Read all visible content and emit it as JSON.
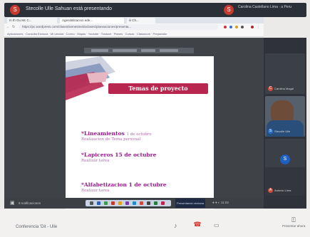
{
  "meet_header": {
    "avatar_initial": "S",
    "presenter_title": "Stecolle Ulle Sahuan está presentando",
    "right_avatar_initial": "S",
    "right_text": "Carolina Castellano Lima · a Peru"
  },
  "browser": {
    "tabs": [
      "In th Gu Mc C...",
      "Agendalizacion ede...",
      "iii Ch..."
    ],
    "url": "https://pc.wordpress.com/clases/semestre/doclases/planeaciones/presenta...",
    "bookmarks": "Aplicaciones · Consulta Esmoca · Mi Unidad · Correo · Mapas · Youtube · Traducir · Planes · Cursos · Classroom · Preparador"
  },
  "slide": {
    "title": "Temas de proyecto",
    "topics": [
      {
        "name": "*Lineamientos",
        "date": "1 de octubre",
        "sub": "Realizacion de Tema personal"
      },
      {
        "name": "*Lapiceros 15 de octubre",
        "date": "",
        "sub": "Realizar tarea"
      },
      {
        "name": "*Alfabetizacion 1 de octubre",
        "date": "",
        "sub": "Realizar tarea"
      }
    ]
  },
  "taskbar": {
    "notification": "9 notificaciones",
    "present_chip": "Presentando ventana",
    "tray": "● ● ◐ 11:02"
  },
  "participants": [
    {
      "initial": "C",
      "name": "Carolina Magal",
      "color": "#d14b3c"
    },
    {
      "initial": "S",
      "name": "Stecolle Ulle",
      "color": "#2c6fd0"
    },
    {
      "initial": "A",
      "name": "Antonio Lima",
      "color": "#d14b3c"
    }
  ],
  "meet_controls": {
    "meeting_code": "Conferencia 'Dit - Ulle",
    "present_label": "Presentar ahora"
  }
}
